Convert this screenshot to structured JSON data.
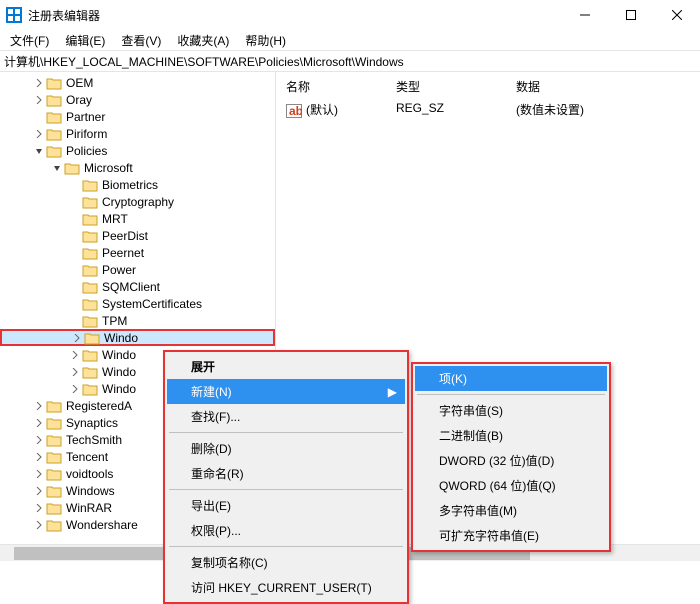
{
  "window": {
    "title": "注册表编辑器"
  },
  "menubar": [
    "文件(F)",
    "编辑(E)",
    "查看(V)",
    "收藏夹(A)",
    "帮助(H)"
  ],
  "address": "计算机\\HKEY_LOCAL_MACHINE\\SOFTWARE\\Policies\\Microsoft\\Windows",
  "tree": [
    {
      "d": 1,
      "a": "r",
      "t": "OEM"
    },
    {
      "d": 1,
      "a": "r",
      "t": "Oray"
    },
    {
      "d": 1,
      "a": "",
      "t": "Partner"
    },
    {
      "d": 1,
      "a": "r",
      "t": "Piriform"
    },
    {
      "d": 1,
      "a": "d",
      "t": "Policies"
    },
    {
      "d": 2,
      "a": "d",
      "t": "Microsoft"
    },
    {
      "d": 3,
      "a": "",
      "t": "Biometrics"
    },
    {
      "d": 3,
      "a": "",
      "t": "Cryptography"
    },
    {
      "d": 3,
      "a": "",
      "t": "MRT"
    },
    {
      "d": 3,
      "a": "",
      "t": "PeerDist"
    },
    {
      "d": 3,
      "a": "",
      "t": "Peernet"
    },
    {
      "d": 3,
      "a": "",
      "t": "Power"
    },
    {
      "d": 3,
      "a": "",
      "t": "SQMClient"
    },
    {
      "d": 3,
      "a": "",
      "t": "SystemCertificates"
    },
    {
      "d": 3,
      "a": "",
      "t": "TPM"
    },
    {
      "d": 3,
      "a": "r",
      "t": "Windo",
      "sel": true
    },
    {
      "d": 3,
      "a": "r",
      "t": "Windo"
    },
    {
      "d": 3,
      "a": "r",
      "t": "Windo"
    },
    {
      "d": 3,
      "a": "r",
      "t": "Windo"
    },
    {
      "d": 1,
      "a": "r",
      "t": "RegisteredA"
    },
    {
      "d": 1,
      "a": "r",
      "t": "Synaptics"
    },
    {
      "d": 1,
      "a": "r",
      "t": "TechSmith"
    },
    {
      "d": 1,
      "a": "r",
      "t": "Tencent"
    },
    {
      "d": 1,
      "a": "r",
      "t": "voidtools"
    },
    {
      "d": 1,
      "a": "r",
      "t": "Windows"
    },
    {
      "d": 1,
      "a": "r",
      "t": "WinRAR"
    },
    {
      "d": 1,
      "a": "r",
      "t": "Wondershare"
    }
  ],
  "columns": {
    "name": "名称",
    "type": "类型",
    "data": "数据"
  },
  "valuerow": {
    "name": "(默认)",
    "type": "REG_SZ",
    "data": "(数值未设置)"
  },
  "ctx1": {
    "expand": "展开",
    "new": "新建(N)",
    "find": "查找(F)...",
    "delete": "删除(D)",
    "rename": "重命名(R)",
    "export": "导出(E)",
    "perm": "权限(P)...",
    "copy": "复制项名称(C)",
    "goto": "访问 HKEY_CURRENT_USER(T)"
  },
  "ctx2": {
    "key": "项(K)",
    "string": "字符串值(S)",
    "binary": "二进制值(B)",
    "dword": "DWORD (32 位)值(D)",
    "qword": "QWORD (64 位)值(Q)",
    "multi": "多字符串值(M)",
    "expand": "可扩充字符串值(E)"
  }
}
